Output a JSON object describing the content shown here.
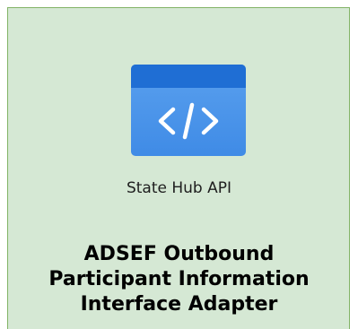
{
  "container": {
    "fill_color": "#d5e8d4",
    "stroke_color": "#82b366",
    "title_lines": [
      "ADSEF Outbound",
      "Participant Information",
      "Interface Adapter"
    ]
  },
  "service": {
    "icon": "api-code-window-icon",
    "icon_glyph": "</>",
    "icon_color_top": "#1f6ed4",
    "icon_color_body": "#5aa0ee",
    "label": "State Hub API"
  }
}
